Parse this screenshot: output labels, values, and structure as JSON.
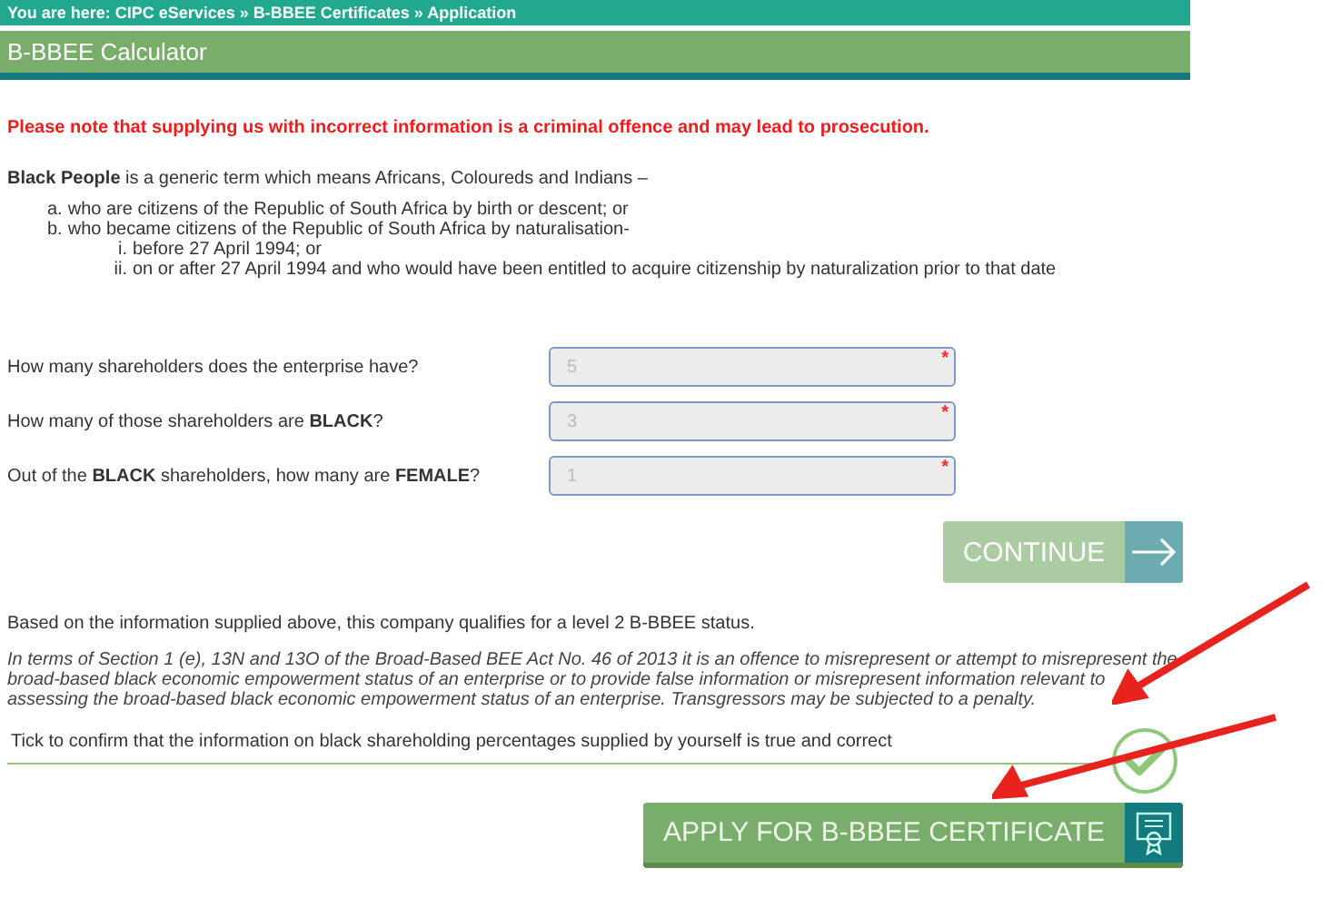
{
  "breadcrumb": "You are here: CIPC eServices » B-BBEE Certificates » Application",
  "panel_title": "B-BBEE Calculator",
  "warning": "Please note that supplying us with incorrect information is a criminal offence and may lead to prosecution.",
  "definition": "**Black People** is a generic term which means Africans, Coloureds and Indians –",
  "definition_list": [
    {
      "marker": "a.",
      "text": "who are citizens of the Republic of South Africa by birth or descent; or"
    },
    {
      "marker": "b.",
      "text": "who became citizens of the Republic of South Africa by naturalisation-",
      "children": [
        {
          "marker": "i.",
          "text": "before 27 April 1994; or"
        },
        {
          "marker": "ii.",
          "text": "on or after 27 April 1994 and who would have been entitled to acquire citizenship by naturalization prior to that date"
        }
      ]
    }
  ],
  "questions": [
    {
      "label": "How many shareholders does the enterprise have?",
      "value": "5",
      "required_mark": "*",
      "disabled": true
    },
    {
      "label": "How many of those shareholders are **BLACK**?",
      "value": "3",
      "required_mark": "*",
      "disabled": true
    },
    {
      "label": "Out of the **BLACK** shareholders, how many are **FEMALE**?",
      "value": "1",
      "required_mark": "*",
      "disabled": true
    }
  ],
  "continue_button": {
    "label": "CONTINUE",
    "disabled": true
  },
  "result": "Based on the information supplied above, this company qualifies for a level 2 B-BBEE status.",
  "legal_notice": "In terms of Section 1 (e), 13N and 13O of the Broad-Based BEE Act No. 46 of 2013 it is an offence to misrepresent or attempt to misrepresent the broad-based black economic empowerment status of an enterprise or to provide false information or misrepresent information relevant to assessing the broad-based black economic empowerment status of an enterprise. Transgressors may be subjected to a penalty.",
  "confirmation": {
    "label": "Tick to confirm that the information on black shareholding percentages supplied by yourself is true and correct",
    "checked": true
  },
  "apply_button": {
    "label": "APPLY FOR B-BBEE CERTIFICATE"
  }
}
